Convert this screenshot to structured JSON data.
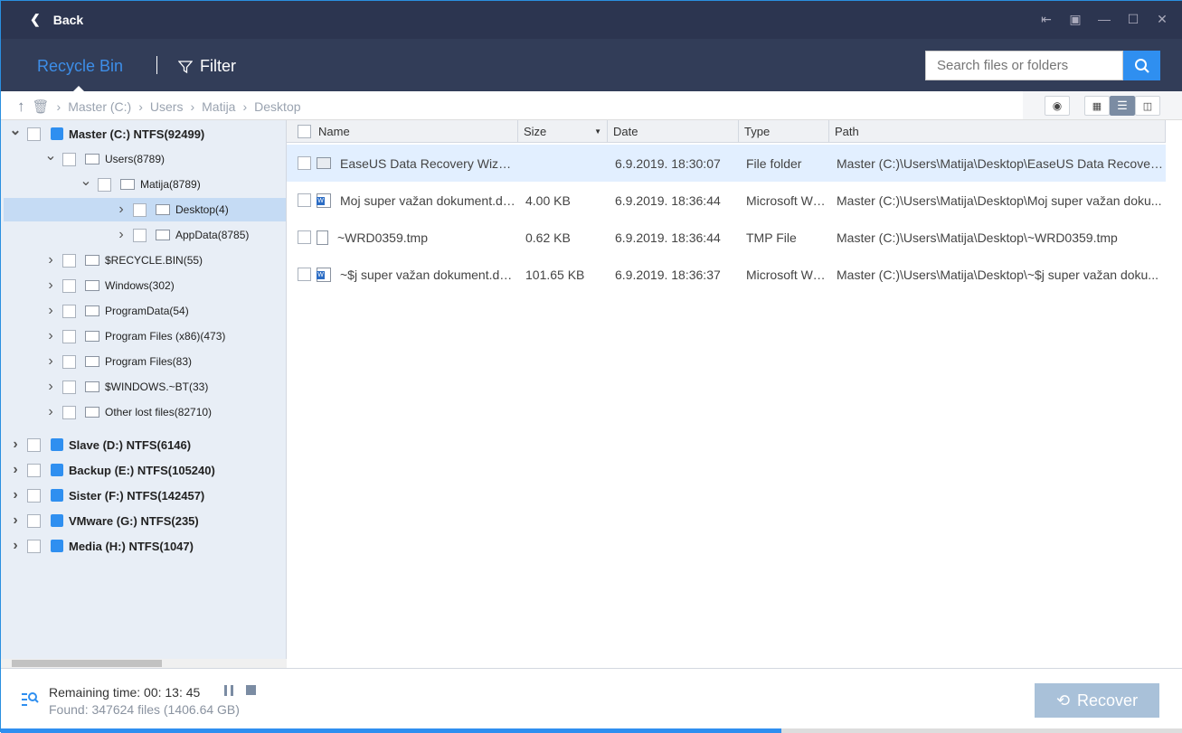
{
  "titlebar": {
    "back_label": "Back"
  },
  "nav": {
    "active_tab": "Recycle Bin",
    "filter_label": "Filter",
    "search_placeholder": "Search files or folders"
  },
  "breadcrumb": [
    "Master (C:)",
    "Users",
    "Matija",
    "Desktop"
  ],
  "tree": [
    {
      "label": "Master (C:) NTFS(92499)",
      "level": 0,
      "expanded": true,
      "drive": true
    },
    {
      "label": "Users(8789)",
      "level": 1,
      "expanded": true
    },
    {
      "label": "Matija(8789)",
      "level": 2,
      "expanded": true
    },
    {
      "label": "Desktop(4)",
      "level": 3,
      "selected": true
    },
    {
      "label": "AppData(8785)",
      "level": 3
    },
    {
      "label": "$RECYCLE.BIN(55)",
      "level": 1
    },
    {
      "label": "Windows(302)",
      "level": 1
    },
    {
      "label": "ProgramData(54)",
      "level": 1
    },
    {
      "label": "Program Files (x86)(473)",
      "level": 1
    },
    {
      "label": "Program Files(83)",
      "level": 1
    },
    {
      "label": "$WINDOWS.~BT(33)",
      "level": 1
    },
    {
      "label": "Other lost files(82710)",
      "level": 1
    },
    {
      "label": "Slave (D:) NTFS(6146)",
      "level": 0,
      "drive": true
    },
    {
      "label": "Backup (E:) NTFS(105240)",
      "level": 0,
      "drive": true
    },
    {
      "label": "Sister (F:) NTFS(142457)",
      "level": 0,
      "drive": true
    },
    {
      "label": "VMware (G:) NTFS(235)",
      "level": 0,
      "drive": true
    },
    {
      "label": "Media (H:) NTFS(1047)",
      "level": 0,
      "drive": true
    }
  ],
  "columns": {
    "name": "Name",
    "size": "Size",
    "date": "Date",
    "type": "Type",
    "path": "Path"
  },
  "files": [
    {
      "name": "EaseUS Data Recovery Wizard ...",
      "size": "",
      "date": "6.9.2019. 18:30:07",
      "type": "File folder",
      "path": "Master (C:)\\Users\\Matija\\Desktop\\EaseUS Data Recovery ...",
      "icon": "folder"
    },
    {
      "name": "Moj super važan dokument.doc...",
      "size": "4.00 KB",
      "date": "6.9.2019. 18:36:44",
      "type": "Microsoft Wo...",
      "path": "Master (C:)\\Users\\Matija\\Desktop\\Moj super važan doku...",
      "icon": "word"
    },
    {
      "name": "~WRD0359.tmp",
      "size": "0.62 KB",
      "date": "6.9.2019. 18:36:44",
      "type": "TMP File",
      "path": "Master (C:)\\Users\\Matija\\Desktop\\~WRD0359.tmp",
      "icon": "file"
    },
    {
      "name": "~$j super važan dokument.docx",
      "size": "101.65 KB",
      "date": "6.9.2019. 18:36:37",
      "type": "Microsoft Wo...",
      "path": "Master (C:)\\Users\\Matija\\Desktop\\~$j super važan doku...",
      "icon": "word"
    }
  ],
  "status": {
    "remaining": "Remaining time: 00: 13: 45",
    "found": "Found: 347624 files (1406.64 GB)",
    "progress_percent": 66
  },
  "recover_label": "Recover",
  "colors": {
    "accent": "#2f8ff0",
    "titlebar": "#2c3550",
    "nav": "#323d58"
  }
}
